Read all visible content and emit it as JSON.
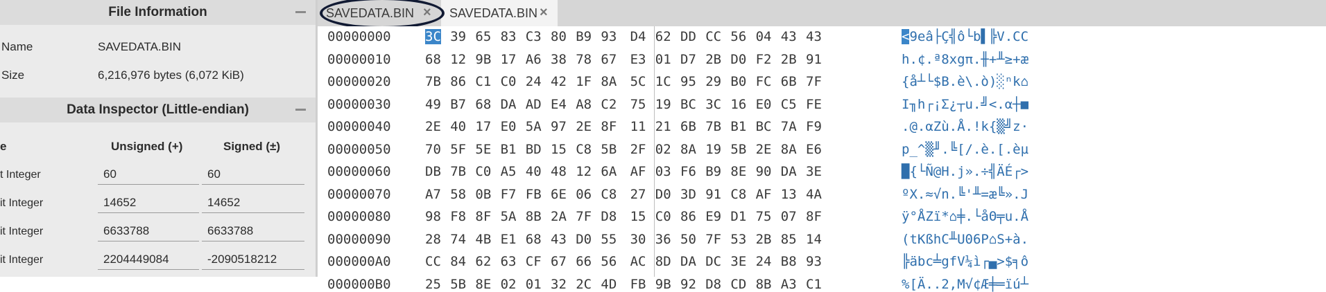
{
  "left_panel": {
    "file_info": {
      "title": "File Information",
      "name_label": "Name",
      "name_value": "SAVEDATA.BIN",
      "size_label": "Size",
      "size_value": "6,216,976 bytes (6,072 KiB)"
    },
    "inspector": {
      "title": "Data Inspector (Little-endian)",
      "col_type": "e",
      "col_unsigned": "Unsigned (+)",
      "col_signed": "Signed (±)",
      "rows": [
        {
          "label": "t Integer",
          "unsigned": "60",
          "signed": "60"
        },
        {
          "label": "it Integer",
          "unsigned": "14652",
          "signed": "14652"
        },
        {
          "label": "it Integer",
          "unsigned": "6633788",
          "signed": "6633788"
        },
        {
          "label": "it Integer",
          "unsigned": "2204449084",
          "signed": "-2090518212"
        }
      ]
    }
  },
  "tabs": [
    {
      "label": "SAVEDATA.BIN",
      "close": "×"
    },
    {
      "label": "SAVEDATA.BIN",
      "close": "×"
    }
  ],
  "hex": {
    "rows": [
      {
        "offset": "00000000",
        "bytes": [
          "3C",
          "39",
          "65",
          "83",
          "C3",
          "80",
          "B9",
          "93",
          "D4",
          "62",
          "DD",
          "CC",
          "56",
          "04",
          "43",
          "43"
        ],
        "ascii_first": "<",
        "ascii_rest": "9eâ├Ç╣ô└b▌╠V.CC"
      },
      {
        "offset": "00000010",
        "bytes": [
          "68",
          "12",
          "9B",
          "17",
          "A6",
          "38",
          "78",
          "67",
          "E3",
          "01",
          "D7",
          "2B",
          "D0",
          "F2",
          "2B",
          "91"
        ],
        "ascii_first": "",
        "ascii_rest": "h.¢.ª8xgπ.╫+╨≥+æ"
      },
      {
        "offset": "00000020",
        "bytes": [
          "7B",
          "86",
          "C1",
          "C0",
          "24",
          "42",
          "1F",
          "8A",
          "5C",
          "1C",
          "95",
          "29",
          "B0",
          "FC",
          "6B",
          "7F"
        ],
        "ascii_first": "",
        "ascii_rest": "{å┴└$B.è\\.ò)░ⁿk⌂"
      },
      {
        "offset": "00000030",
        "bytes": [
          "49",
          "B7",
          "68",
          "DA",
          "AD",
          "E4",
          "A8",
          "C2",
          "75",
          "19",
          "BC",
          "3C",
          "16",
          "E0",
          "C5",
          "FE"
        ],
        "ascii_first": "",
        "ascii_rest": "I╖h┌¡Σ¿┬u.╝<.α┼■"
      },
      {
        "offset": "00000040",
        "bytes": [
          "2E",
          "40",
          "17",
          "E0",
          "5A",
          "97",
          "2E",
          "8F",
          "11",
          "21",
          "6B",
          "7B",
          "B1",
          "BC",
          "7A",
          "F9"
        ],
        "ascii_first": "",
        "ascii_rest": ".@.αZù.Å.!k{▒╝z·"
      },
      {
        "offset": "00000050",
        "bytes": [
          "70",
          "5F",
          "5E",
          "B1",
          "BD",
          "15",
          "C8",
          "5B",
          "2F",
          "02",
          "8A",
          "19",
          "5B",
          "2E",
          "8A",
          "E6"
        ],
        "ascii_first": "",
        "ascii_rest": "p_^▒╜.╚[/.è.[.èµ"
      },
      {
        "offset": "00000060",
        "bytes": [
          "DB",
          "7B",
          "C0",
          "A5",
          "40",
          "48",
          "12",
          "6A",
          "AF",
          "03",
          "F6",
          "B9",
          "8E",
          "90",
          "DA",
          "3E"
        ],
        "ascii_first": "",
        "ascii_rest": "█{└Ñ@H.j».÷╣ÄÉ┌>"
      },
      {
        "offset": "00000070",
        "bytes": [
          "A7",
          "58",
          "0B",
          "F7",
          "FB",
          "6E",
          "06",
          "C8",
          "27",
          "D0",
          "3D",
          "91",
          "C8",
          "AF",
          "13",
          "4A"
        ],
        "ascii_first": "",
        "ascii_rest": "ºX.≈√n.╚'╨=æ╚».J"
      },
      {
        "offset": "00000080",
        "bytes": [
          "98",
          "F8",
          "8F",
          "5A",
          "8B",
          "2A",
          "7F",
          "D8",
          "15",
          "C0",
          "86",
          "E9",
          "D1",
          "75",
          "07",
          "8F"
        ],
        "ascii_first": "",
        "ascii_rest": "ÿ°ÅZï*⌂╪.└åΘ╤u.Å"
      },
      {
        "offset": "00000090",
        "bytes": [
          "28",
          "74",
          "4B",
          "E1",
          "68",
          "43",
          "D0",
          "55",
          "30",
          "36",
          "50",
          "7F",
          "53",
          "2B",
          "85",
          "14"
        ],
        "ascii_first": "",
        "ascii_rest": "(tKßhC╨U06P⌂S+à."
      },
      {
        "offset": "000000A0",
        "bytes": [
          "CC",
          "84",
          "62",
          "63",
          "CF",
          "67",
          "66",
          "56",
          "AC",
          "8D",
          "DA",
          "DC",
          "3E",
          "24",
          "B8",
          "93"
        ],
        "ascii_first": "",
        "ascii_rest": "╠äbc╧gfV¼ì┌▄>$╕ô"
      },
      {
        "offset": "000000B0",
        "bytes": [
          "25",
          "5B",
          "8E",
          "02",
          "01",
          "32",
          "2C",
          "4D",
          "FB",
          "9B",
          "92",
          "D8",
          "CD",
          "8B",
          "A3",
          "C1"
        ],
        "ascii_first": "",
        "ascii_rest": "%[Ä..2,M√¢Æ╪═ïú┴"
      }
    ]
  },
  "colors": {
    "selection": "#3b86c9",
    "ascii_text": "#2f6fad"
  }
}
